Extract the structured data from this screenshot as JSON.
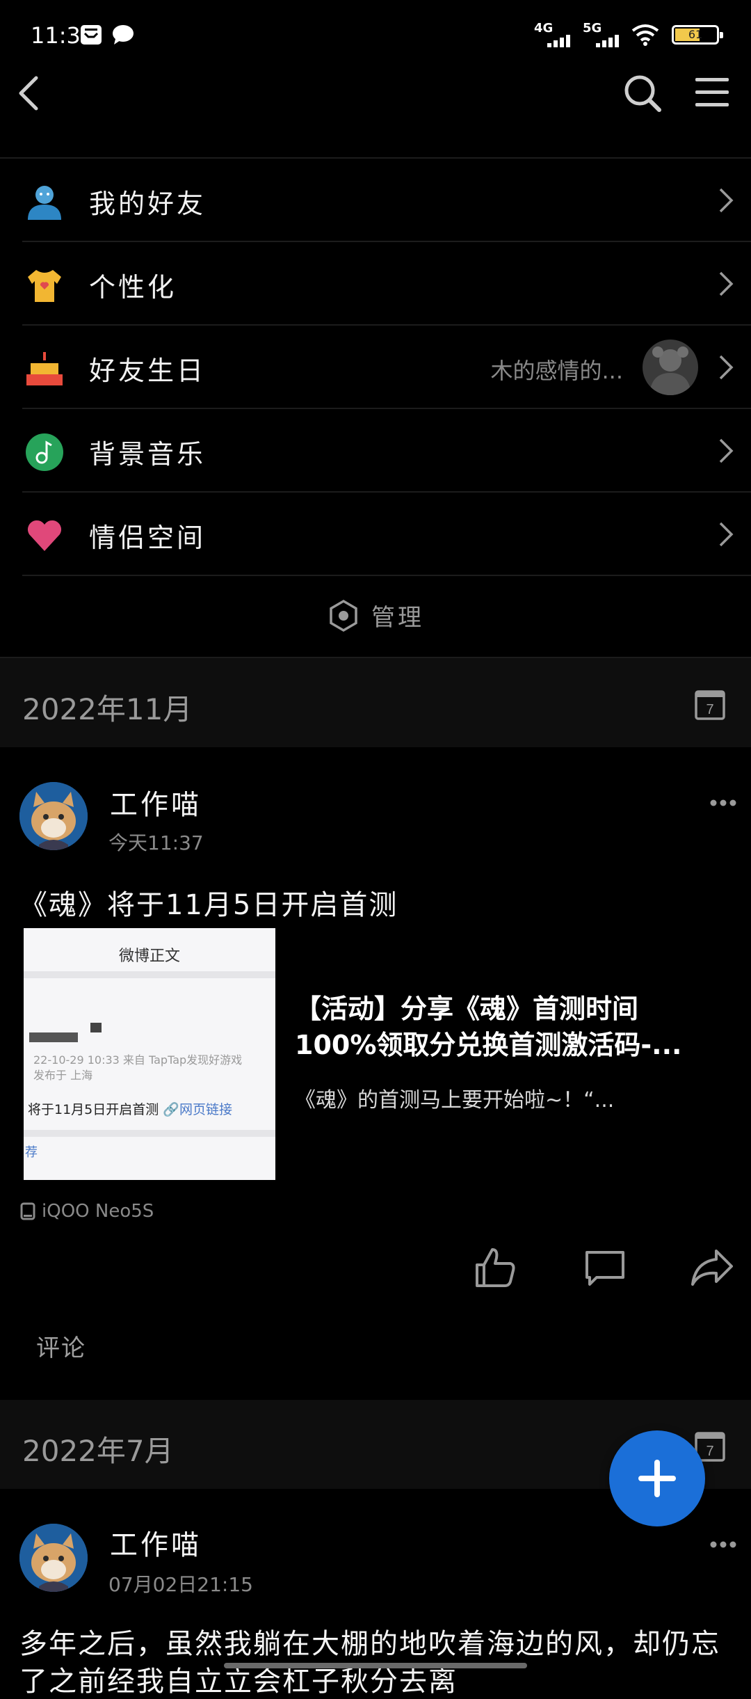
{
  "status_bar": {
    "time": "11:37",
    "network_1": "4G",
    "network_2": "5G",
    "battery_text": "61",
    "battery_level": 0.61
  },
  "menu": {
    "items": [
      {
        "label": "我的好友",
        "icon": "person-icon"
      },
      {
        "label": "个性化",
        "icon": "tshirt-icon"
      },
      {
        "label": "好友生日",
        "icon": "cake-icon",
        "extra": "木的感情的..."
      },
      {
        "label": "背景音乐",
        "icon": "music-note-icon"
      },
      {
        "label": "情侣空间",
        "icon": "heart-icon"
      }
    ],
    "manage_label": "管理"
  },
  "feed": {
    "months": [
      "2022年11月",
      "2022年7月"
    ],
    "calendar_day": "7",
    "post1": {
      "author": "工作喵",
      "time": "今天11:37",
      "text": "《魂》将于11月5日开启首测",
      "share": {
        "title": "【活动】分享《魂》首测时间100%领取分兑换首测激活码-...",
        "desc": "《魂》的首测马上要开始啦~！“...",
        "thumb_title": "微博正文",
        "thumb_meta_1": "22-10-29 10:33  来自 TapTap发现好游戏",
        "thumb_meta_2": "发布于 上海",
        "thumb_text": "将于11月5日开启首测",
        "thumb_link": "🔗网页链接",
        "thumb_rec": "荐"
      },
      "device": "iQOO Neo5S",
      "comment_label": "评论"
    },
    "post2": {
      "author": "工作喵",
      "time": "07月02日21:15",
      "text_line1": "多年之后，虽然我躺在大棚的地吹着海边的风，却仍忘",
      "text_line2": "了之前经我自立立会杠子秋分去离"
    }
  },
  "colors": {
    "background": "#000000",
    "accent": "#1b6fd8",
    "divider": "#1c1c1c",
    "muted_text": "#8a8a8a"
  }
}
